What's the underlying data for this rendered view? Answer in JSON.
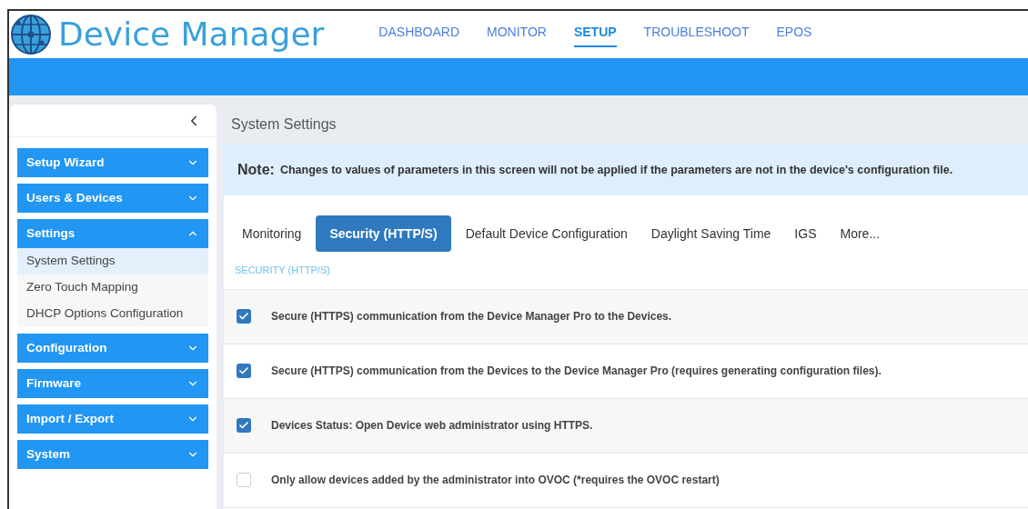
{
  "app": {
    "title": "Device Manager"
  },
  "nav": [
    {
      "label": "DASHBOARD",
      "selected": false
    },
    {
      "label": "MONITOR",
      "selected": false
    },
    {
      "label": "SETUP",
      "selected": true
    },
    {
      "label": "TROUBLESHOOT",
      "selected": false
    },
    {
      "label": "EPOS",
      "selected": false
    }
  ],
  "sidebar": {
    "groups": [
      {
        "label": "Setup Wizard",
        "expanded": false
      },
      {
        "label": "Users & Devices",
        "expanded": false
      },
      {
        "label": "Settings",
        "expanded": true,
        "items": [
          {
            "label": "System Settings",
            "selected": true
          },
          {
            "label": "Zero Touch Mapping",
            "selected": false
          },
          {
            "label": "DHCP Options Configuration",
            "selected": false
          }
        ]
      },
      {
        "label": "Configuration",
        "expanded": false
      },
      {
        "label": "Firmware",
        "expanded": false
      },
      {
        "label": "Import / Export",
        "expanded": false
      },
      {
        "label": "System",
        "expanded": false
      }
    ]
  },
  "page": {
    "title": "System Settings",
    "note": {
      "label": "Note:",
      "text": "Changes to values of parameters in this screen will not be applied if the parameters are not in the device's configuration file."
    },
    "tabs": [
      {
        "label": "Monitoring",
        "selected": false
      },
      {
        "label": "Security (HTTP/S)",
        "selected": true
      },
      {
        "label": "Default Device Configuration",
        "selected": false
      },
      {
        "label": "Daylight Saving Time",
        "selected": false
      },
      {
        "label": "IGS",
        "selected": false
      },
      {
        "label": "More...",
        "selected": false
      }
    ],
    "section_title": "SECURITY (HTTP/S)",
    "options": [
      {
        "label": "Secure (HTTPS) communication from the Device Manager Pro to the Devices.",
        "checked": true
      },
      {
        "label": "Secure (HTTPS) communication from the Devices to the Device Manager Pro (requires generating configuration files).",
        "checked": true
      },
      {
        "label": "Devices Status: Open Device web administrator using HTTPS.",
        "checked": true
      },
      {
        "label": "Only allow devices added by the administrator into OVOC (*requires the OVOC restart)",
        "checked": false
      }
    ]
  }
}
